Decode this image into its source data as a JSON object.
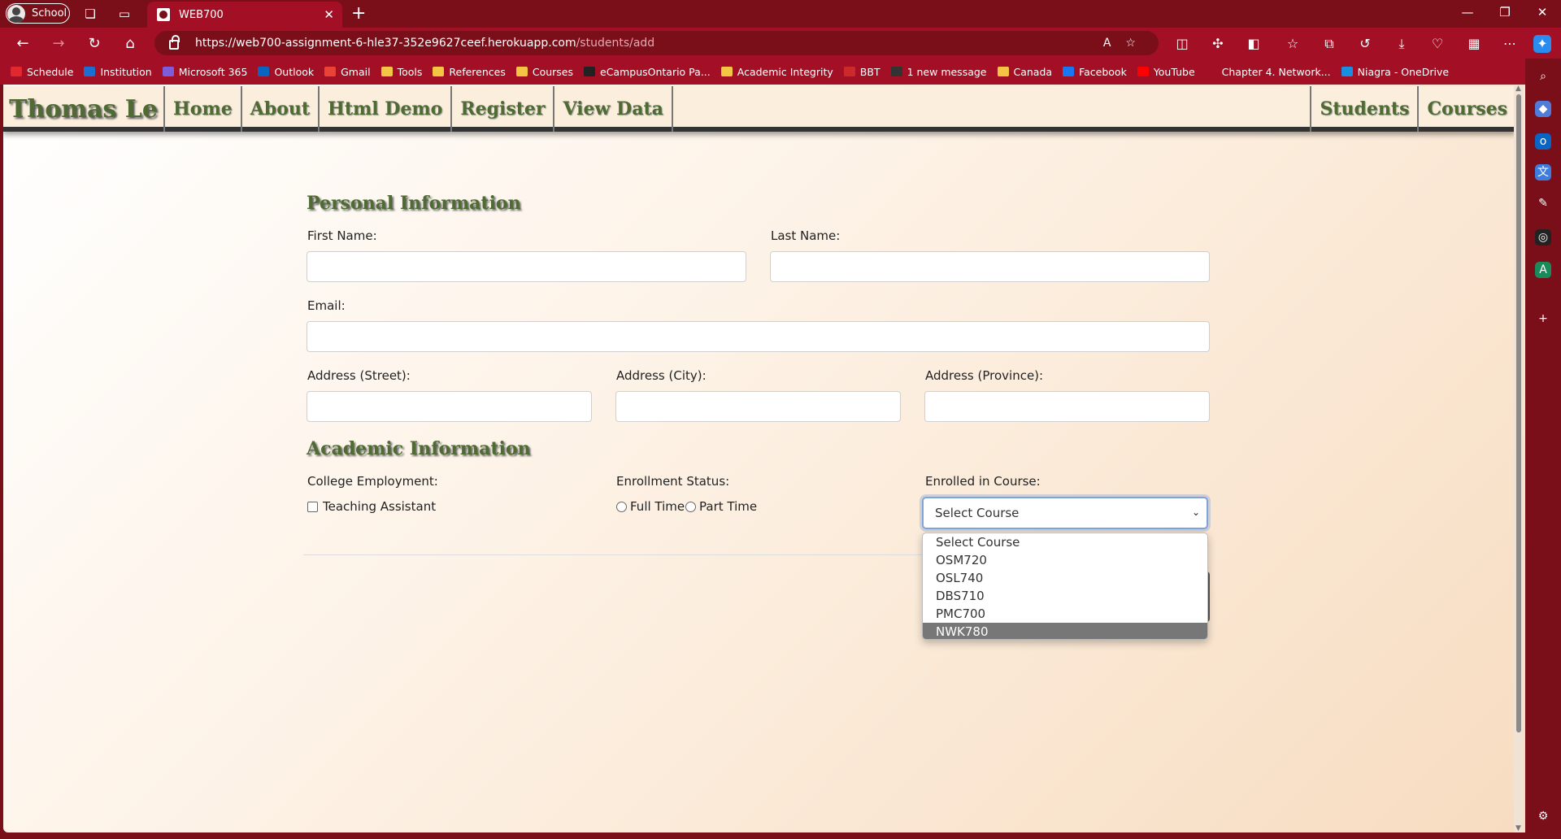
{
  "browser": {
    "profile": "School",
    "tab_title": "WEB700",
    "url_host": "https://web700-assignment-6-hle37-352e9627ceef.herokuapp.com",
    "url_path": "/students/add"
  },
  "bookmarks": [
    {
      "label": "Schedule",
      "icon": "schedule-icon",
      "color": "#e0282e"
    },
    {
      "label": "Institution",
      "icon": "institution-icon",
      "color": "#1a6fd1"
    },
    {
      "label": "Microsoft 365",
      "icon": "m365-icon",
      "color": "#7f5cd9"
    },
    {
      "label": "Outlook",
      "icon": "outlook-icon",
      "color": "#0a64c2"
    },
    {
      "label": "Gmail",
      "icon": "gmail-icon",
      "color": "#ea4335"
    },
    {
      "label": "Tools",
      "icon": "folder-icon",
      "color": "#f4c542"
    },
    {
      "label": "References",
      "icon": "folder-icon",
      "color": "#f4c542"
    },
    {
      "label": "Courses",
      "icon": "folder-icon",
      "color": "#f4c542"
    },
    {
      "label": "eCampusOntario Pa...",
      "icon": "ecampus-icon",
      "color": "#222222"
    },
    {
      "label": "Academic Integrity",
      "icon": "folder-icon",
      "color": "#f4c542"
    },
    {
      "label": "BBT",
      "icon": "bbt-icon",
      "color": "#cc2a2a"
    },
    {
      "label": "1 new message",
      "icon": "message-icon",
      "color": "#333333"
    },
    {
      "label": "Canada",
      "icon": "folder-icon",
      "color": "#f4c542"
    },
    {
      "label": "Facebook",
      "icon": "facebook-icon",
      "color": "#1877f2"
    },
    {
      "label": "YouTube",
      "icon": "youtube-icon",
      "color": "#ff0000"
    },
    {
      "label": "Chapter 4. Network...",
      "icon": "page-icon",
      "color": "#a30f24"
    },
    {
      "label": "Niagra - OneDrive",
      "icon": "onedrive-icon",
      "color": "#1a8fe0"
    }
  ],
  "site": {
    "brand": "Thomas Le",
    "nav_left": [
      "Home",
      "About",
      "Html Demo",
      "Register",
      "View Data"
    ],
    "nav_right": [
      "Students",
      "Courses"
    ]
  },
  "form": {
    "personal_heading": "Personal Information",
    "first_name": "First Name:",
    "last_name": "Last Name:",
    "email": "Email:",
    "street": "Address (Street):",
    "city": "Address (City):",
    "province": "Address (Province):",
    "academic_heading": "Academic Information",
    "college_employment": "College Employment:",
    "teaching_assistant": "Teaching Assistant",
    "enrollment_status": "Enrollment Status:",
    "full_time": "Full Time",
    "part_time": "Part Time",
    "enrolled_in_course": "Enrolled in Course:",
    "course_selected": "Select Course",
    "course_options": [
      "Select Course",
      "OSM720",
      "OSL740",
      "DBS710",
      "PMC700",
      "NWK780"
    ],
    "highlighted_option": "NWK780"
  }
}
